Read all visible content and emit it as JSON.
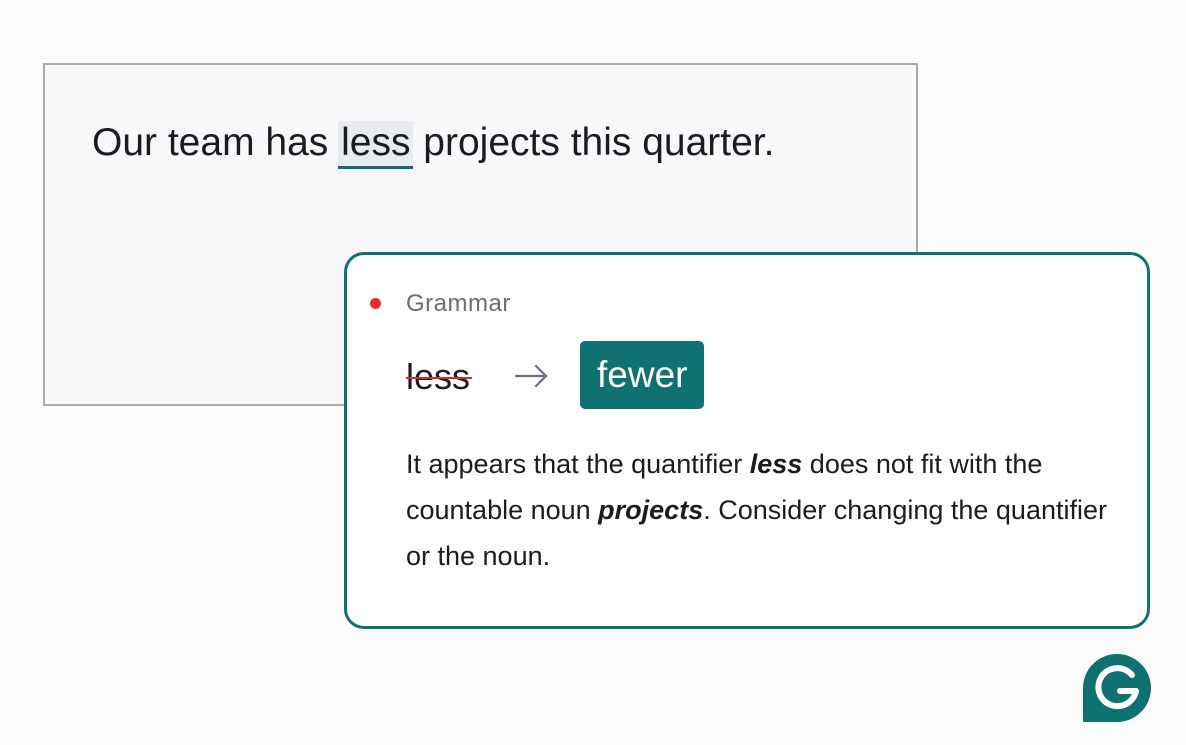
{
  "editor": {
    "text_before": "Our team has ",
    "flagged_word": "less",
    "text_after": " projects this quarter."
  },
  "card": {
    "category": "Grammar",
    "original_word": "less",
    "suggestion": "fewer",
    "explanation": {
      "part1": "It appears that the quantifier ",
      "emph1": "less",
      "part2": " does not fit with the countable noun ",
      "emph2": "projects",
      "part3": ". Consider changing the quantifier or the noun."
    }
  },
  "icons": {
    "dot": "red-dot-icon",
    "arrow": "arrow-right-icon",
    "logo": "grammarly-logo-icon"
  },
  "colors": {
    "accent": "#0f7171",
    "error_dot": "#ec2c33",
    "strike": "#e0242d",
    "underline": "#0e6e6e",
    "category_text": "#6c6c73"
  }
}
